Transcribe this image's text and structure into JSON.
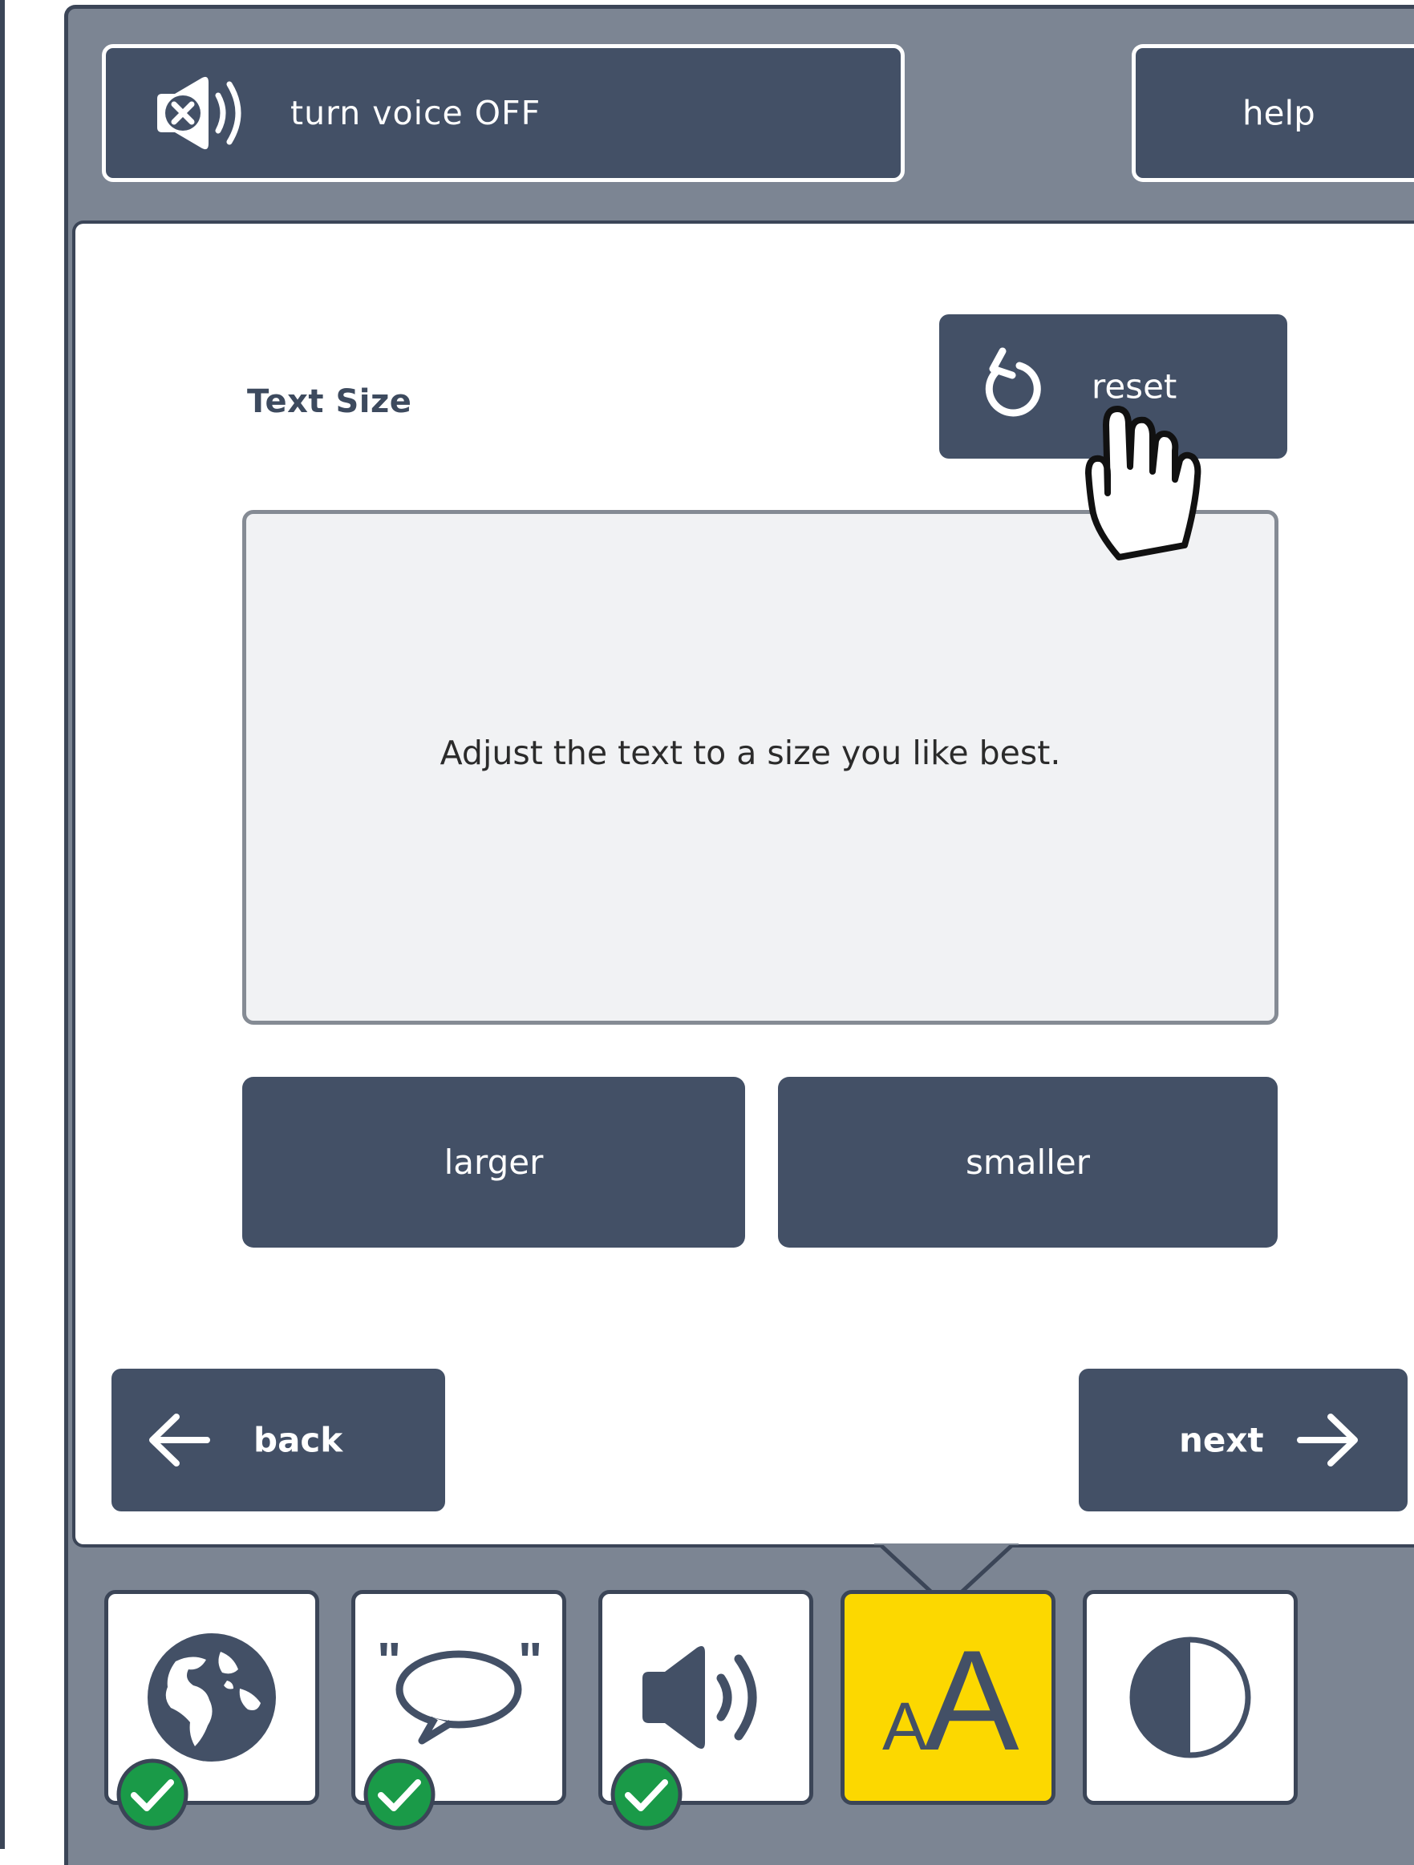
{
  "header": {
    "voice_button_label": "turn voice OFF",
    "help_button_label": "help"
  },
  "main": {
    "section_title": "Text Size",
    "reset_button_label": "reset",
    "preview_text": "Adjust the text to a size you like best.",
    "larger_button_label": "larger",
    "smaller_button_label": "smaller"
  },
  "navigation": {
    "back_label": "back",
    "next_label": "next"
  },
  "bottom_bar": {
    "tiles": [
      {
        "name": "language",
        "icon": "globe-icon",
        "completed": true,
        "active": false
      },
      {
        "name": "speech",
        "icon": "speech-bubble-icon",
        "completed": true,
        "active": false
      },
      {
        "name": "volume",
        "icon": "speaker-icon",
        "completed": true,
        "active": false
      },
      {
        "name": "text-size",
        "icon": "text-size-icon",
        "icon_text_small": "A",
        "icon_text_large": "A",
        "completed": false,
        "active": true
      },
      {
        "name": "contrast",
        "icon": "contrast-icon",
        "completed": false,
        "active": false
      }
    ]
  },
  "colors": {
    "frame": "#7c8593",
    "button": "#435066",
    "accent_active": "#fcd800",
    "check": "#1a9a48"
  }
}
